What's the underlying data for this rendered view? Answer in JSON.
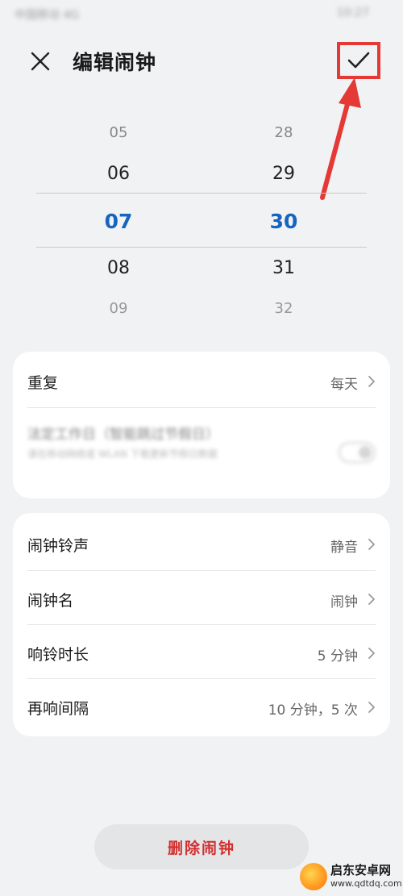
{
  "status_bar": {
    "left": "中国移动 4G",
    "right": "10:27"
  },
  "header": {
    "title": "编辑闹钟"
  },
  "picker": {
    "hours": [
      "05",
      "06",
      "07",
      "08",
      "09"
    ],
    "minutes": [
      "28",
      "29",
      "30",
      "31",
      "32"
    ],
    "selected_hour": "07",
    "selected_minute": "30"
  },
  "settings_card_1": {
    "repeat": {
      "label": "重复",
      "value": "每天"
    },
    "workday": {
      "title": "法定工作日（智能跳过节假日）",
      "subtitle": "请在移动网络或 WLAN 下载更新节假日数据"
    }
  },
  "settings_card_2": {
    "rows": [
      {
        "label": "闹钟铃声",
        "value": "静音"
      },
      {
        "label": "闹钟名",
        "value": "闹钟"
      },
      {
        "label": "响铃时长",
        "value": "5 分钟"
      },
      {
        "label": "再响间隔",
        "value": "10 分钟，5 次"
      }
    ]
  },
  "delete_button": {
    "label": "删除闹钟"
  },
  "watermark": {
    "title": "启东安卓网",
    "url": "www.qdtdq.com"
  },
  "colors": {
    "accent": "#1565c0",
    "danger": "#d32f2f",
    "annotation": "#e53935"
  },
  "icons": {
    "close": "close-icon",
    "confirm": "checkmark-icon",
    "chevron": "chevron-right-icon"
  }
}
